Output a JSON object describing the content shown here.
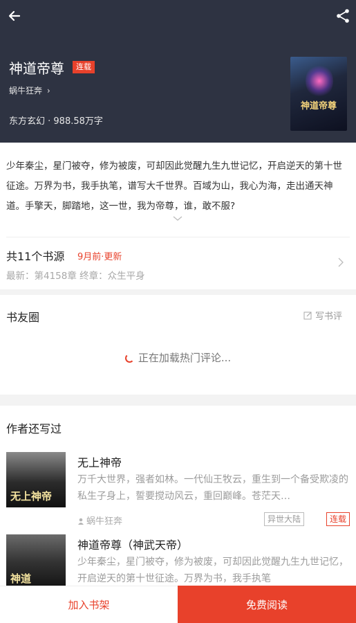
{
  "header": {
    "title": "神道帝尊",
    "status_badge": "连载",
    "author": "蜗牛狂奔",
    "author_chevron": "›",
    "meta": "东方玄幻 · 988.58万字",
    "cover_text": "神道帝尊",
    "back_icon": "arrow-left-icon",
    "share_icon": "share-icon"
  },
  "intro": {
    "synopsis": "少年秦尘，星门被夺，修为被废，可却因此觉醒九生九世记忆，开启逆天的第十世征途。万界为书，我手执笔，谱写大千世界。百域为山，我心为海，走出通天神道。手擎天，脚踏地，这一世，我为帝尊，谁，敢不服?"
  },
  "sources": {
    "title": "共11个书源",
    "update": "9月前·更新",
    "latest": "最新：第4158章 终章：众生平身"
  },
  "circle": {
    "title": "书友圈",
    "write_review": "写书评",
    "loading": "正在加载热门评论..."
  },
  "others": {
    "title": "作者还写过",
    "books": [
      {
        "title": "无上神帝",
        "desc": "万千大世界，强者如林。一代仙王牧云，重生到一个备受欺凌的私生子身上，誓要搅动风云，重回巅峰。苍茫天…",
        "author": "蜗牛狂奔",
        "genre": "异世大陆",
        "status": "连载",
        "cover_text": "无上神帝"
      },
      {
        "title": "神道帝尊（神武天帝）",
        "desc": "少年秦尘，星门被夺，修为被废，可却因此觉醒九生九世记忆，开启逆天的第十世征途。万界为书，我手执笔",
        "cover_text": "神道"
      }
    ]
  },
  "bottom_bar": {
    "add_shelf": "加入书架",
    "read_free": "免费阅读"
  },
  "colors": {
    "accent": "#e8412b",
    "header_bg": "#2e3342"
  }
}
